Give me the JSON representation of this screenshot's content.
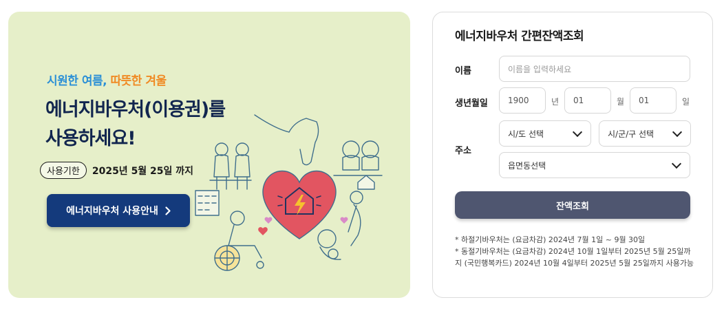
{
  "banner": {
    "tagline_part1": "시원한 여름,",
    "tagline_part2": "따뜻한 겨울",
    "headline_line1": "에너지바우처(이용권)를",
    "headline_line2": "사용하세요!",
    "period_badge": "사용기한",
    "period_text": "2025년 5월 25일 까지",
    "guide_button": "에너지바우처 사용안내",
    "guide_button_icon": "chevron-right-icon",
    "colors": {
      "background": "#e6efc9",
      "button": "#143a7c",
      "headline": "#12264f",
      "accent_blue": "#2a8fd6",
      "accent_orange": "#f08a24",
      "heart": "#e25561"
    }
  },
  "form": {
    "title": "에너지바우처 간편잔액조회",
    "name_label": "이름",
    "name_placeholder": "이름을 입력하세요",
    "birth_label": "생년월일",
    "year_value": "1900",
    "year_unit": "년",
    "month_value": "01",
    "month_unit": "월",
    "day_value": "01",
    "day_unit": "일",
    "address_label": "주소",
    "sido_select": "시/도 선택",
    "sigungu_select": "시/군/구 선택",
    "eupmyeondong_select": "읍면동선택",
    "submit_label": "잔액조회",
    "colors": {
      "submit": "#4f5670"
    }
  },
  "notes": {
    "line1": "* 하절기바우처는 (요금차감) 2024년 7월 1일 ~ 9월 30일",
    "line2": "* 동절기바우처는 (요금차감) 2024년 10월 1일부터 2025년 5월 25일까지 (국민행복카드) 2024년 10월 4일부터 2025년 5월 25일까지 사용가능"
  }
}
